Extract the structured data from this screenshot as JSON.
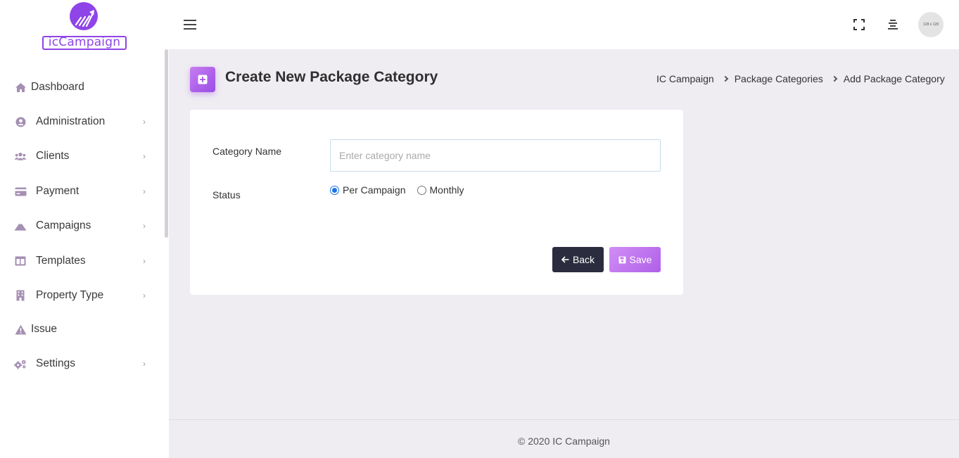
{
  "app": {
    "logo_text": "icCampaign"
  },
  "sidebar": {
    "items": [
      {
        "label": "Dashboard",
        "icon": "home-icon",
        "has_submenu": false
      },
      {
        "label": "Administration",
        "icon": "user-circle-icon",
        "has_submenu": true
      },
      {
        "label": "Clients",
        "icon": "users-icon",
        "has_submenu": true
      },
      {
        "label": "Payment",
        "icon": "credit-card-icon",
        "has_submenu": true
      },
      {
        "label": "Campaigns",
        "icon": "mountain-icon",
        "has_submenu": true
      },
      {
        "label": "Templates",
        "icon": "layout-icon",
        "has_submenu": true
      },
      {
        "label": "Property Type",
        "icon": "building-icon",
        "has_submenu": true
      },
      {
        "label": "Issue",
        "icon": "warning-icon",
        "has_submenu": false
      },
      {
        "label": "Settings",
        "icon": "gears-icon",
        "has_submenu": true
      }
    ]
  },
  "topbar": {
    "avatar_text": "128 x 128"
  },
  "page": {
    "title": "Create New Package Category",
    "breadcrumb": [
      "IC Campaign",
      "Package Categories",
      "Add Package Category"
    ]
  },
  "form": {
    "category_name_label": "Category Name",
    "category_name_placeholder": "Enter category name",
    "category_name_value": "",
    "status_label": "Status",
    "status_options": [
      "Per Campaign",
      "Monthly"
    ],
    "status_selected": "Per Campaign",
    "back_label": "Back",
    "save_label": "Save"
  },
  "footer": {
    "text": "© 2020 IC Campaign"
  },
  "colors": {
    "accent": "#8f44e8",
    "sidebar_icon": "#a58fb3",
    "back_button": "#2b2c3e",
    "save_button": "#c27af0",
    "background": "#efecf2"
  }
}
